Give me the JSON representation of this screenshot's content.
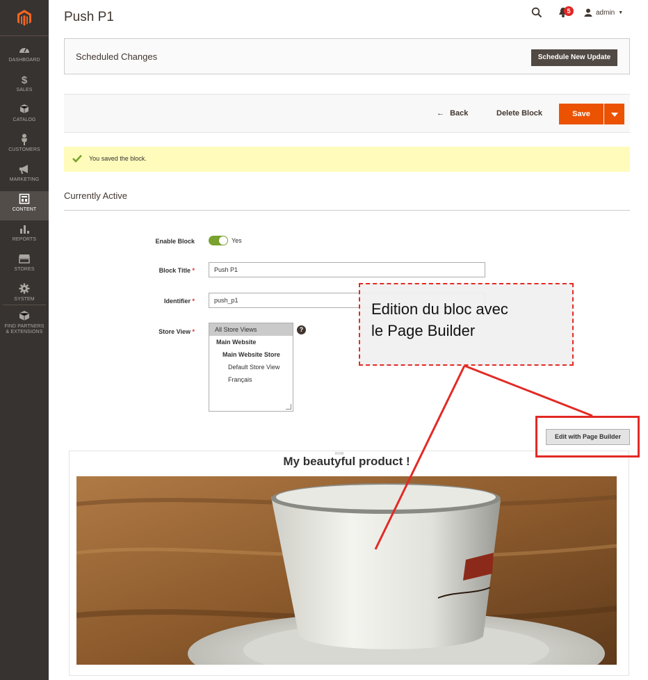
{
  "colors": {
    "accent": "#eb5202",
    "sidebar": "#373330",
    "annotation": "#e22a25",
    "success": "#79a22e"
  },
  "sidebar": {
    "items": [
      {
        "label": "DASHBOARD",
        "icon": "gauge-icon"
      },
      {
        "label": "SALES",
        "icon": "dollar-icon"
      },
      {
        "label": "CATALOG",
        "icon": "cube-icon"
      },
      {
        "label": "CUSTOMERS",
        "icon": "person-icon"
      },
      {
        "label": "MARKETING",
        "icon": "megaphone-icon"
      },
      {
        "label": "CONTENT",
        "icon": "layout-icon"
      },
      {
        "label": "REPORTS",
        "icon": "bar-chart-icon"
      },
      {
        "label": "STORES",
        "icon": "storefront-icon"
      },
      {
        "label": "SYSTEM",
        "icon": "gear-icon"
      },
      {
        "label": "FIND PARTNERS",
        "icon": "box-icon"
      },
      {
        "label": "& EXTENSIONS",
        "icon": ""
      }
    ]
  },
  "header": {
    "title": "Push P1",
    "notifications_count": "5",
    "user": "admin"
  },
  "scheduled": {
    "title": "Scheduled Changes",
    "button": "Schedule New Update"
  },
  "toolbar": {
    "back": "Back",
    "delete": "Delete Block",
    "save": "Save"
  },
  "message": {
    "text": "You saved the block."
  },
  "section": {
    "title": "Currently Active"
  },
  "form": {
    "enable_label": "Enable Block",
    "enable_value": "Yes",
    "title_label": "Block Title",
    "title_value": "Push P1",
    "identifier_label": "Identifier",
    "identifier_value": "push_p1",
    "store_label": "Store View",
    "store_options": [
      "All Store Views",
      "Main Website",
      "Main Website Store",
      "Default Store View",
      "Français"
    ],
    "help": "?"
  },
  "page_builder": {
    "edit_button": "Edit with Page Builder",
    "row_label": "ROW",
    "heading": "My beautyful product !"
  },
  "annotation": {
    "line1": "Edition du bloc avec",
    "line2": "le Page Builder"
  }
}
